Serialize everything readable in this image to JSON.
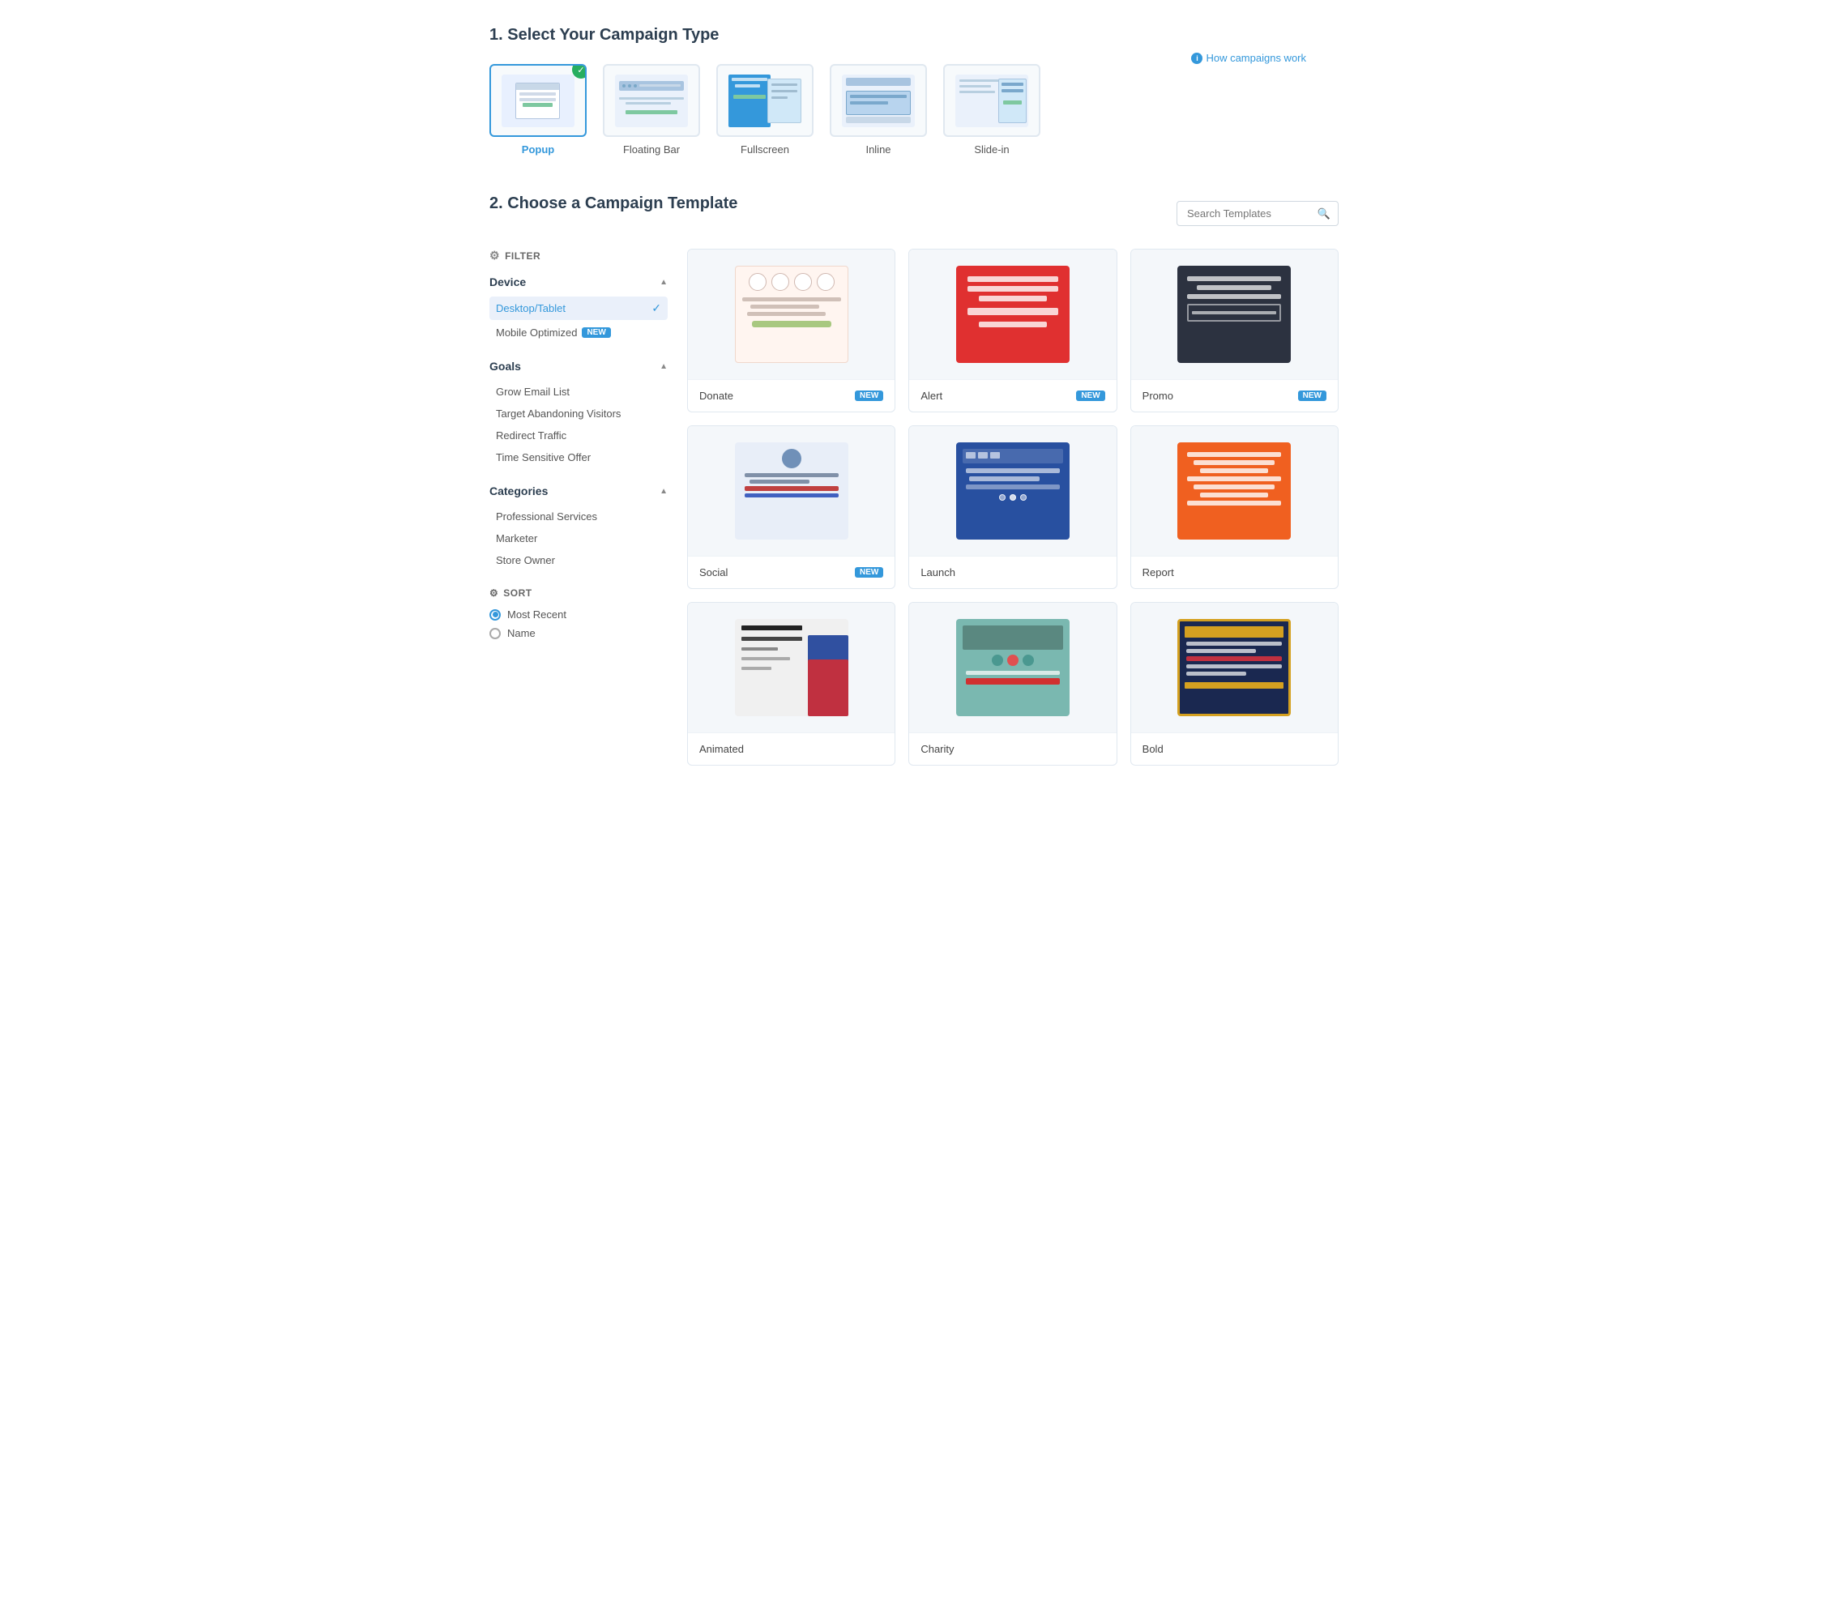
{
  "section1": {
    "title": "1. Select Your Campaign Type",
    "how_campaigns": "How campaigns work",
    "types": [
      {
        "id": "popup",
        "label": "Popup",
        "selected": true
      },
      {
        "id": "floating-bar",
        "label": "Floating Bar",
        "selected": false
      },
      {
        "id": "fullscreen",
        "label": "Fullscreen",
        "selected": false
      },
      {
        "id": "inline",
        "label": "Inline",
        "selected": false
      },
      {
        "id": "slide-in",
        "label": "Slide-in",
        "selected": false
      }
    ]
  },
  "section2": {
    "title": "2. Choose a Campaign Template",
    "search_placeholder": "Search Templates",
    "filter_label": "FILTER",
    "device": {
      "label": "Device",
      "options": [
        {
          "id": "desktop",
          "label": "Desktop/Tablet",
          "selected": true
        },
        {
          "id": "mobile",
          "label": "Mobile Optimized",
          "selected": false,
          "badge": "NEW"
        }
      ]
    },
    "goals": {
      "label": "Goals",
      "items": [
        {
          "id": "grow-email",
          "label": "Grow Email List"
        },
        {
          "id": "target-abandoning",
          "label": "Target Abandoning Visitors"
        },
        {
          "id": "redirect-traffic",
          "label": "Redirect Traffic"
        },
        {
          "id": "time-sensitive",
          "label": "Time Sensitive Offer"
        }
      ]
    },
    "categories": {
      "label": "Categories",
      "items": [
        {
          "id": "professional",
          "label": "Professional Services"
        },
        {
          "id": "marketer",
          "label": "Marketer"
        },
        {
          "id": "store-owner",
          "label": "Store Owner"
        }
      ]
    },
    "sort": {
      "label": "SORT",
      "options": [
        {
          "id": "most-recent",
          "label": "Most Recent",
          "selected": true
        },
        {
          "id": "name",
          "label": "Name",
          "selected": false
        }
      ]
    },
    "templates": [
      {
        "id": "donate",
        "name": "Donate",
        "badge": "NEW"
      },
      {
        "id": "alert",
        "name": "Alert",
        "badge": "NEW"
      },
      {
        "id": "promo",
        "name": "Promo",
        "badge": "NEW"
      },
      {
        "id": "social",
        "name": "Social",
        "badge": "NEW"
      },
      {
        "id": "launch",
        "name": "Launch",
        "badge": null
      },
      {
        "id": "report",
        "name": "Report",
        "badge": null
      },
      {
        "id": "card7",
        "name": "Animated",
        "badge": null
      },
      {
        "id": "card8",
        "name": "Charity",
        "badge": null
      },
      {
        "id": "card9",
        "name": "Bold",
        "badge": null
      }
    ]
  }
}
